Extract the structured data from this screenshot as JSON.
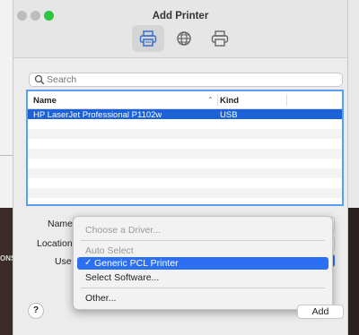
{
  "window": {
    "title": "Add Printer"
  },
  "toolbar": {
    "items": [
      "Default",
      "IP",
      "Windows"
    ]
  },
  "search": {
    "placeholder": "Search",
    "value": ""
  },
  "printer_list": {
    "columns": {
      "name": "Name",
      "kind": "Kind"
    },
    "rows": [
      {
        "name": "HP LaserJet Professional P1102w",
        "kind": "USB",
        "selected": true
      }
    ]
  },
  "form": {
    "name_label": "Name",
    "location_label": "Location",
    "use_label": "Use"
  },
  "driver_menu": {
    "title": "Choose a Driver...",
    "items": [
      {
        "label": "Auto Select",
        "enabled": false
      },
      {
        "label": "Generic PCL Printer",
        "checked": true,
        "highlighted": true
      },
      {
        "label": "Select Software...",
        "enabled": true
      },
      {
        "label": "Other...",
        "enabled": true
      }
    ]
  },
  "buttons": {
    "help": "?",
    "add": "Add"
  },
  "background": {
    "left_text": "ONS"
  },
  "colors": {
    "accent": "#2d6ff2",
    "selection": "#1c61d6",
    "list_border": "#5a9ff0"
  }
}
